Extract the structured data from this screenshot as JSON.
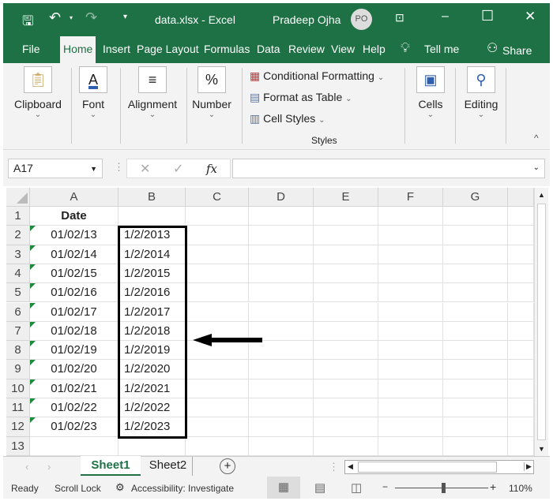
{
  "title_bar": {
    "file_title": "data.xlsx  -  Excel",
    "user_name": "Pradeep Ojha",
    "user_initials": "PO"
  },
  "tabs": [
    "File",
    "Home",
    "Insert",
    "Page Layout",
    "Formulas",
    "Data",
    "Review",
    "View",
    "Help",
    "Tell me",
    "Share"
  ],
  "ribbon": {
    "clipboard": "Clipboard",
    "font": "Font",
    "alignment": "Alignment",
    "number": "Number",
    "conditional_formatting": "Conditional Formatting",
    "format_as_table": "Format as Table",
    "cell_styles": "Cell Styles",
    "styles_group": "Styles",
    "cells": "Cells",
    "editing": "Editing",
    "font_icon": "A",
    "number_icon": "%"
  },
  "formula_bar": {
    "name_box": "A17",
    "formula": "",
    "fx": "fx"
  },
  "columns": [
    "A",
    "B",
    "C",
    "D",
    "E",
    "F",
    "G"
  ],
  "rows": [
    "1",
    "2",
    "3",
    "4",
    "5",
    "6",
    "7",
    "8",
    "9",
    "10",
    "11",
    "12",
    "13"
  ],
  "cells": {
    "A": [
      "Date",
      "01/02/13",
      "01/02/14",
      "01/02/15",
      "01/02/16",
      "01/02/17",
      "01/02/18",
      "01/02/19",
      "01/02/20",
      "01/02/21",
      "01/02/22",
      "01/02/23"
    ],
    "B": [
      "",
      "1/2/2013",
      "1/2/2014",
      "1/2/2015",
      "1/2/2016",
      "1/2/2017",
      "1/2/2018",
      "1/2/2019",
      "1/2/2020",
      "1/2/2021",
      "1/2/2022",
      "1/2/2023"
    ]
  },
  "sheets": {
    "active": "Sheet1",
    "other": "Sheet2"
  },
  "status": {
    "ready": "Ready",
    "scroll_lock": "Scroll Lock",
    "accessibility": "Accessibility: Investigate",
    "zoom": "110%",
    "zoom_value": 110
  },
  "colors": {
    "excel_green": "#1e7145",
    "error_triangle": "#1e8a3e"
  }
}
